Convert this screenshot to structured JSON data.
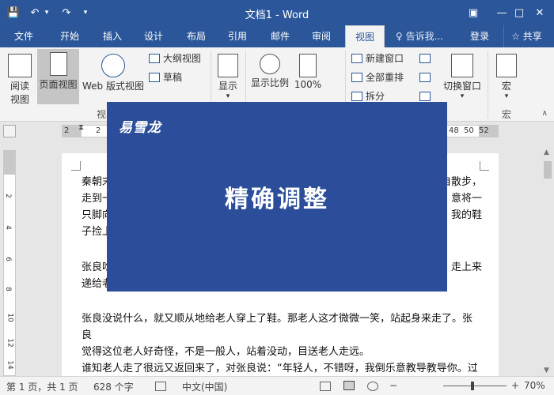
{
  "titlebar": {
    "title": "文档1 - Word",
    "save_icon": "💾",
    "undo_icon": "↶",
    "redo_icon": "↷",
    "customize_icon": "▾",
    "ribbon_options_icon": "▣",
    "minimize_icon": "—",
    "maximize_icon": "□",
    "close_icon": "✕"
  },
  "tabs": [
    "文件",
    "开始",
    "插入",
    "设计",
    "布局",
    "引用",
    "邮件",
    "审阅",
    "视图"
  ],
  "tellme": {
    "icon": "♀",
    "text": "告诉我..."
  },
  "login": "登录",
  "share": "共享",
  "share_icon": "☆",
  "ribbon": {
    "read_mode": "阅读\n视图",
    "read_mode_l1": "阅读",
    "read_mode_l2": "视图",
    "print_layout": "页面视图",
    "web_layout": "Web 版式视图",
    "outline": "大纲视图",
    "draft": "草稿",
    "views_group": "视",
    "show": "显示",
    "zoom": "显示比例",
    "zoom_100": "100%",
    "new_window": "新建窗口",
    "arrange_all": "全部重排",
    "split": "拆分",
    "switch_windows": "切换窗口",
    "macros": "宏",
    "macros_group": "宏",
    "collapse_icon": "∧",
    "dropdown_icon": "▾"
  },
  "ruler": {
    "numbers_left": [
      "2",
      "2"
    ],
    "numbers_right": [
      "48",
      "50",
      "52"
    ]
  },
  "vruler_numbers": [
    "2",
    "4",
    "6",
    "8",
    "10",
    "12",
    "14"
  ],
  "document": {
    "para1_l1": "秦朝末",
    "para1_l1_end": "自散步，",
    "para1_l2": "走到一",
    "para1_l2_end": "意将一",
    "para1_l3": "只脚向",
    "para1_l3_end": "我的鞋",
    "para1_l4": "子捡上",
    "para2_l1": "张良吃",
    "para2_l1_end": "走上来",
    "para2_l2": "递给老",
    "para3_l1": "张良没说什么，就又顺从地给老人穿上了鞋。那老人这才微微一笑，站起身来走了。张良",
    "para3_l2": "觉得这位老人好奇怪，不是一般人，站着没动，目送老人走远。",
    "para4_l1": "谁知老人走了很远又返回来了，对张良说：“年轻人，不错呀，我倒乐意教导教导你。过"
  },
  "overlay": {
    "brand": "易雪龙",
    "headline": "精确调整"
  },
  "statusbar": {
    "page": "第 1 页，共 1 页",
    "words": "628 个字",
    "language": "中文(中国)",
    "zoom_minus": "−",
    "zoom_plus": "+",
    "zoom_level": "70%"
  },
  "colors": {
    "word_blue": "#2b579a",
    "overlay_blue": "#2b4d9a"
  }
}
